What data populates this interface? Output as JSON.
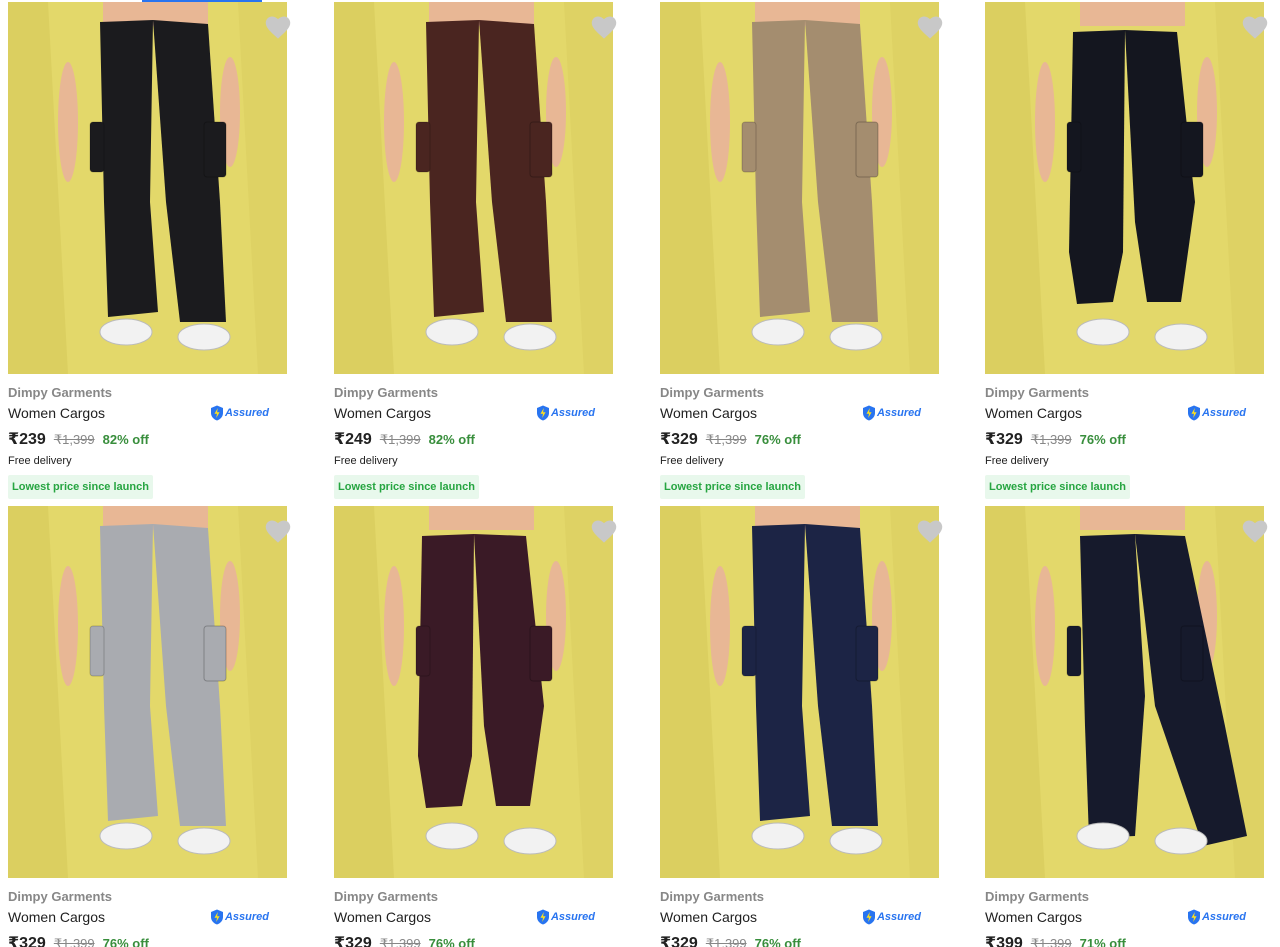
{
  "products": [
    {
      "brand": "Dimpy Garments",
      "title": "Women Cargos",
      "assured": "Assured",
      "price": "₹239",
      "mrp": "₹1,399",
      "off": "82% off",
      "delivery": "Free delivery",
      "badge": "Lowest price since launch",
      "pant_color": "#1b1b1e",
      "style": "straight"
    },
    {
      "brand": "Dimpy Garments",
      "title": "Women Cargos",
      "assured": "Assured",
      "price": "₹249",
      "mrp": "₹1,399",
      "off": "82% off",
      "delivery": "Free delivery",
      "badge": "Lowest price since launch",
      "pant_color": "#4a2520",
      "style": "straight"
    },
    {
      "brand": "Dimpy Garments",
      "title": "Women Cargos",
      "assured": "Assured",
      "price": "₹329",
      "mrp": "₹1,399",
      "off": "76% off",
      "delivery": "Free delivery",
      "badge": "Lowest price since launch",
      "pant_color": "#a48d6f",
      "style": "straight"
    },
    {
      "brand": "Dimpy Garments",
      "title": "Women Cargos",
      "assured": "Assured",
      "price": "₹329",
      "mrp": "₹1,399",
      "off": "76% off",
      "delivery": "Free delivery",
      "badge": "Lowest price since launch",
      "pant_color": "#14161f",
      "style": "jogger"
    },
    {
      "brand": "Dimpy Garments",
      "title": "Women Cargos",
      "assured": "Assured",
      "price": "₹329",
      "mrp": "₹1,399",
      "off": "76% off",
      "pant_color": "#a9abb0",
      "style": "straight"
    },
    {
      "brand": "Dimpy Garments",
      "title": "Women Cargos",
      "assured": "Assured",
      "price": "₹329",
      "mrp": "₹1,399",
      "off": "76% off",
      "pant_color": "#3a1a26",
      "style": "jogger"
    },
    {
      "brand": "Dimpy Garments",
      "title": "Women Cargos",
      "assured": "Assured",
      "price": "₹329",
      "mrp": "₹1,399",
      "off": "76% off",
      "pant_color": "#1c2445",
      "style": "straight"
    },
    {
      "brand": "Dimpy Garments",
      "title": "Women Cargos",
      "assured": "Assured",
      "price": "₹399",
      "mrp": "₹1,399",
      "off": "71% off",
      "pant_color": "#161a2c",
      "style": "parachute"
    }
  ],
  "colors": {
    "image_bg": "#e3d86a",
    "skin": "#e8b795",
    "shoe": "#f2f2f2",
    "wishlist": "#c8c8c8",
    "assured_blue": "#2874f0"
  }
}
